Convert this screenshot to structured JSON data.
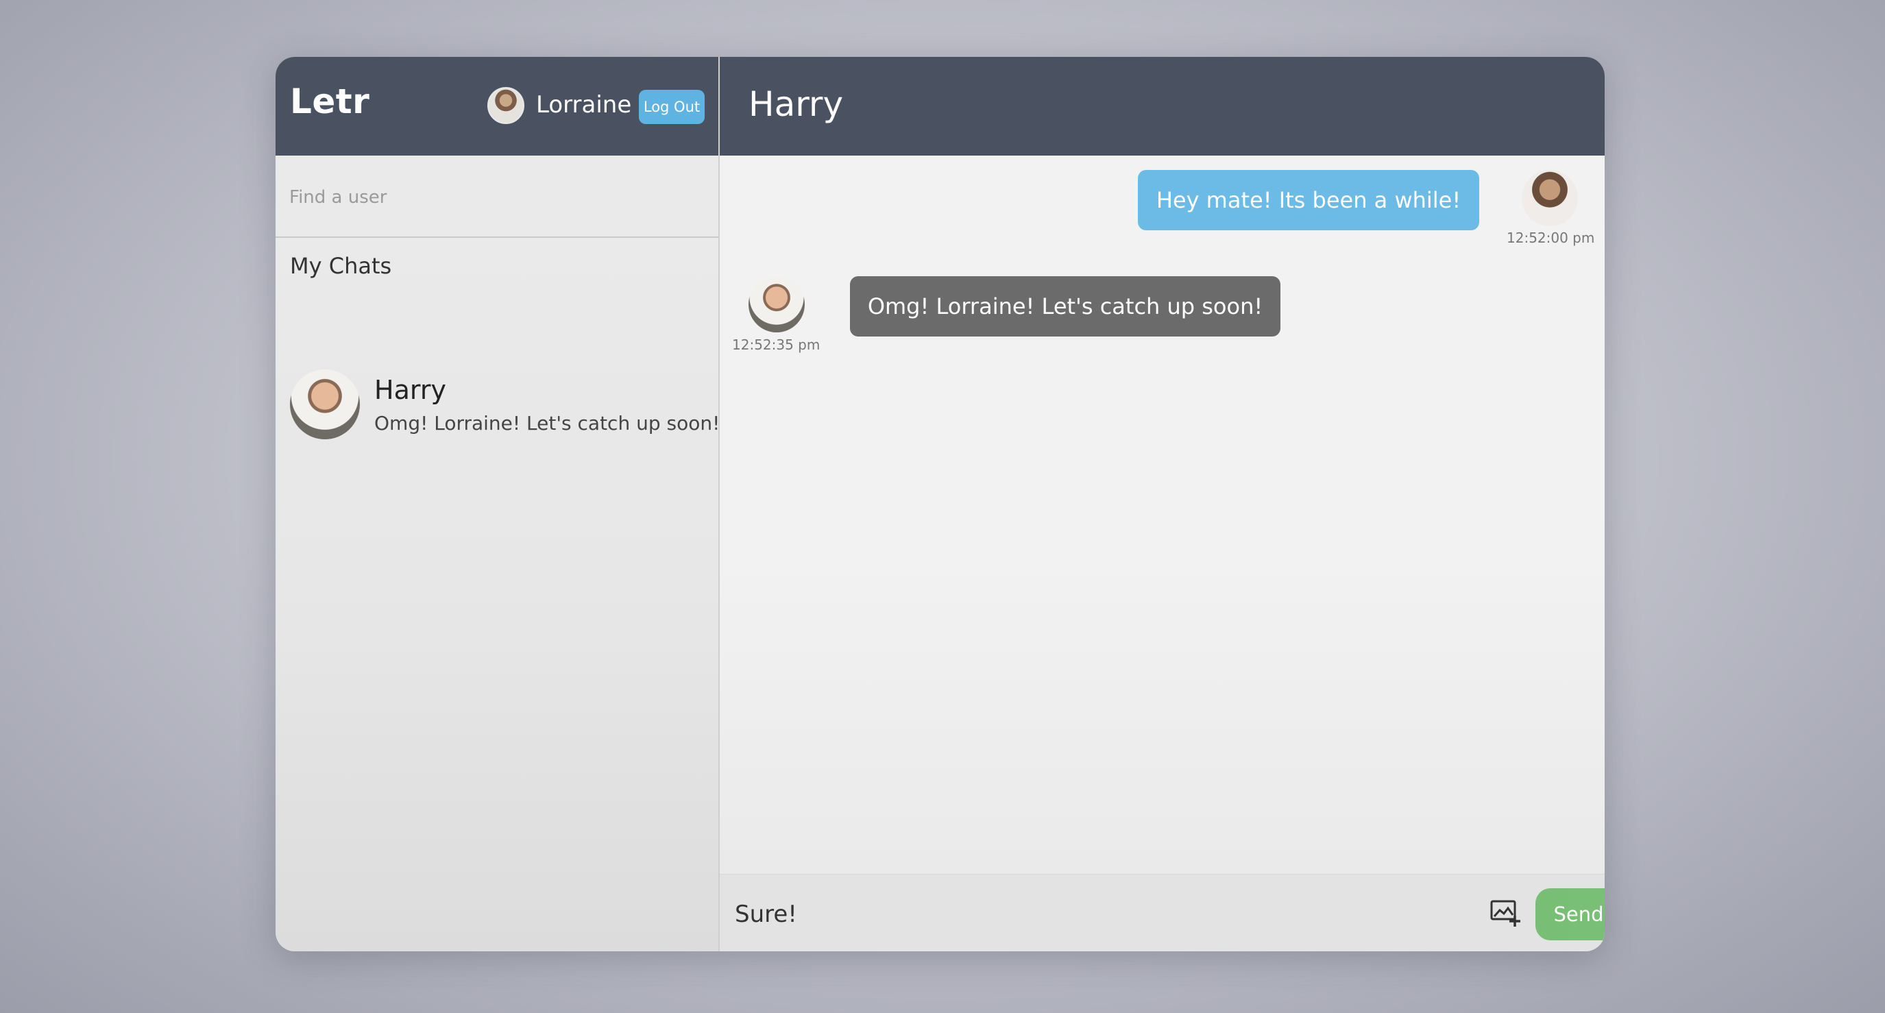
{
  "app": {
    "name": "Letr"
  },
  "current_user": {
    "name": "Lorraine",
    "logout_label": "Log Out"
  },
  "search": {
    "placeholder": "Find a user",
    "value": ""
  },
  "sidebar": {
    "section_title": "My Chats",
    "chats": [
      {
        "name": "Harry",
        "preview": "Omg! Lorraine! Let's catch up soon!"
      }
    ]
  },
  "conversation": {
    "title": "Harry",
    "messages": [
      {
        "sender": "me",
        "text": "Hey mate! Its been a while!",
        "time": "12:52:00 pm"
      },
      {
        "sender": "Harry",
        "text": "Omg! Lorraine! Let's catch up soon!",
        "time": "12:52:35 pm"
      }
    ]
  },
  "composer": {
    "value": "Sure!",
    "send_label": "Send",
    "attach_icon": "add-image-icon"
  },
  "colors": {
    "header": "#4a5161",
    "outgoing_bubble": "#6cbae6",
    "incoming_bubble": "#6b6b6b",
    "send_button": "#6dbb6a",
    "logout_button": "#5fb3e2"
  }
}
